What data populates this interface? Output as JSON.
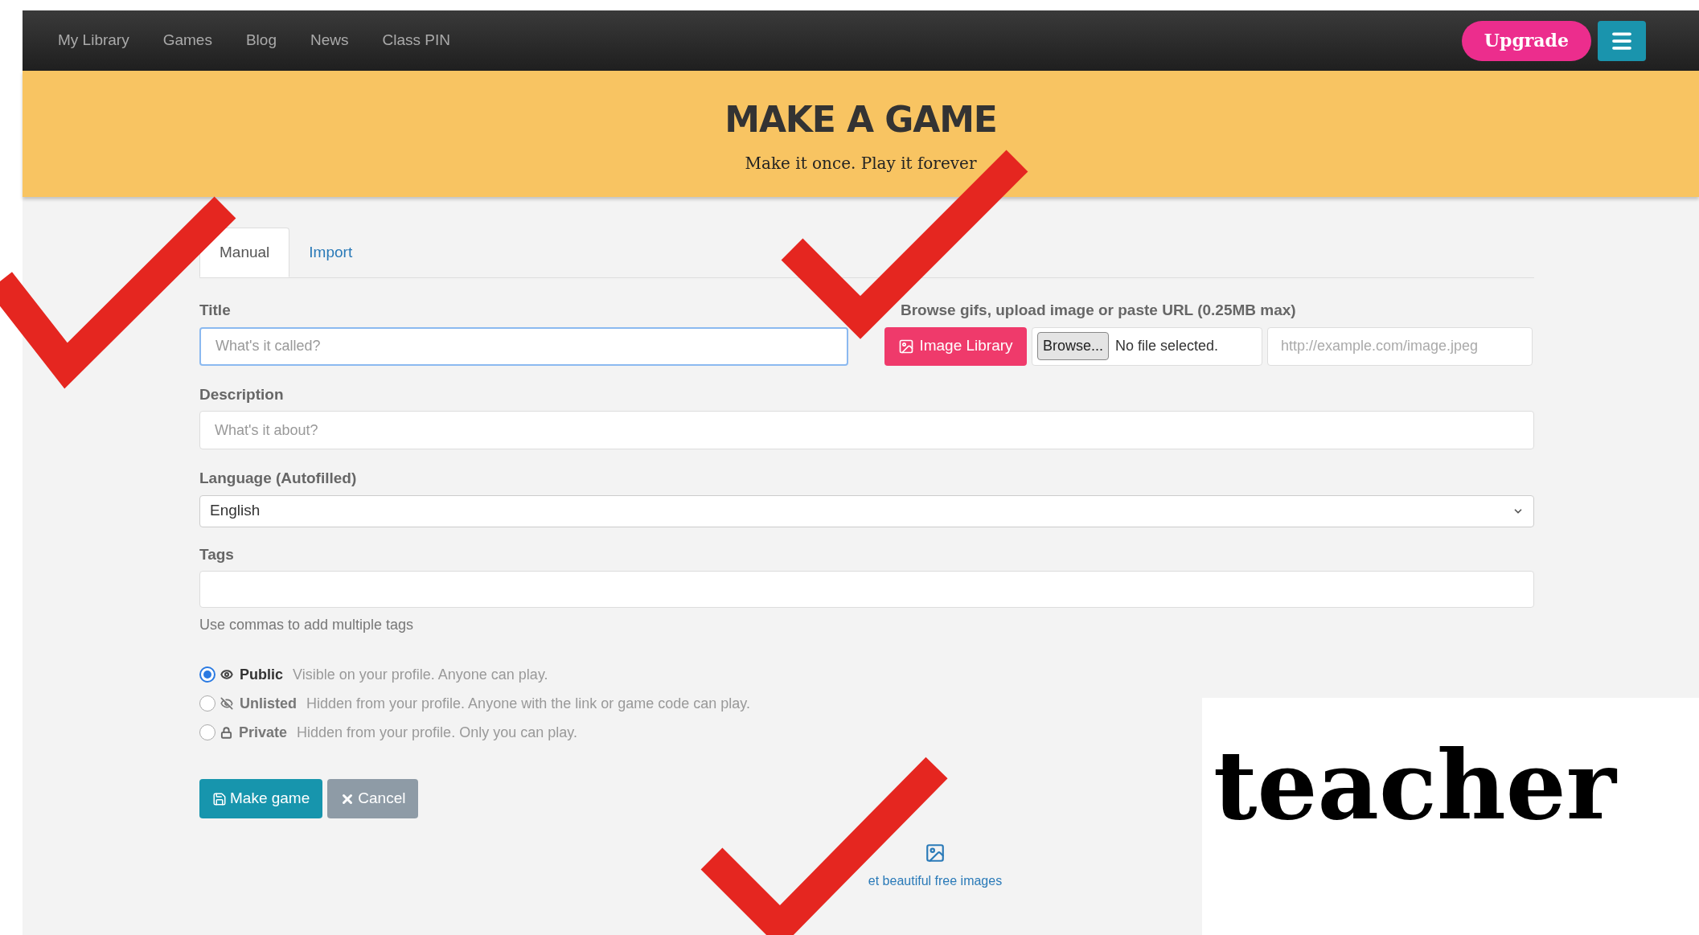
{
  "navbar": {
    "links": [
      "My Library",
      "Games",
      "Blog",
      "News",
      "Class PIN"
    ],
    "upgrade": "Upgrade"
  },
  "banner": {
    "title": "MAKE A GAME",
    "subtitle": "Make it once. Play it forever"
  },
  "tabs": [
    {
      "label": "Manual",
      "selected": true
    },
    {
      "label": "Import",
      "selected": false
    }
  ],
  "title_field": {
    "label": "Title",
    "placeholder": "What's it called?"
  },
  "image": {
    "label": "Browse gifs, upload image or paste URL (0.25MB max)",
    "library_button": "Image Library",
    "browse_button": "Browse...",
    "file_status": "No file selected.",
    "url_placeholder": "http://example.com/image.jpeg"
  },
  "description_field": {
    "label": "Description",
    "placeholder": "What's it about?"
  },
  "language_field": {
    "label": "Language (Autofilled)",
    "value": "English"
  },
  "tags_field": {
    "label": "Tags",
    "help": "Use commas to add multiple tags"
  },
  "visibility": [
    {
      "kind": "eye",
      "name": "Public",
      "description": "Visible on your profile. Anyone can play.",
      "selected": true
    },
    {
      "kind": "eye-slash",
      "name": "Unlisted",
      "description": "Hidden from your profile. Anyone with the link or game code can play.",
      "selected": false
    },
    {
      "kind": "lock",
      "name": "Private",
      "description": "Hidden from your profile. Only you can play.",
      "selected": false
    }
  ],
  "buttons": {
    "make": "Make game",
    "cancel": "Cancel"
  },
  "footer_link": "et beautiful free images",
  "overlay": {
    "graphic_text": "teacher"
  }
}
